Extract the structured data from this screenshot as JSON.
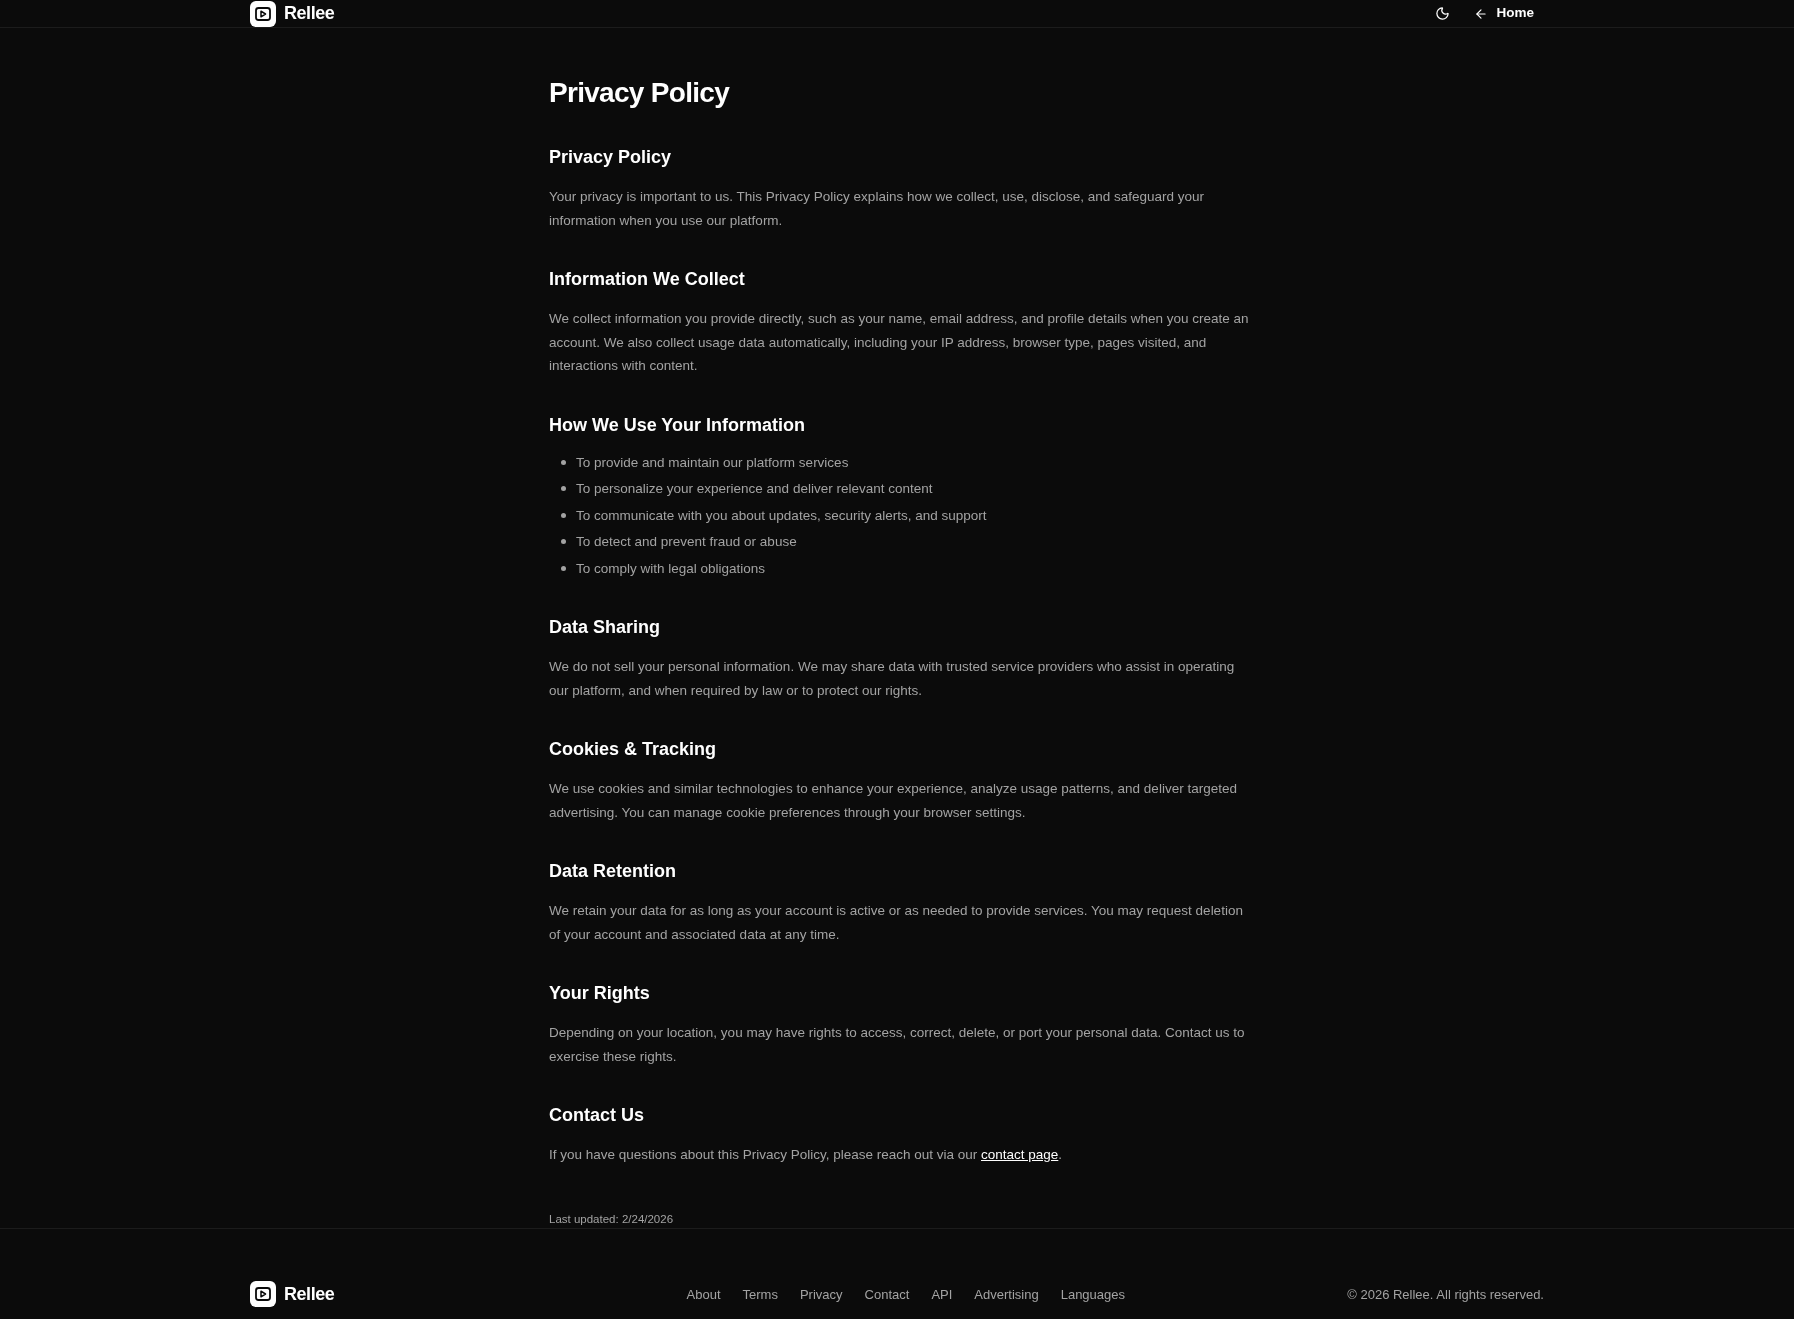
{
  "header": {
    "brand": "Rellee",
    "home_link": "Home"
  },
  "page": {
    "title": "Privacy Policy",
    "sections": [
      {
        "kind": "paragraph",
        "heading": "Privacy Policy",
        "text": "Your privacy is important to us. This Privacy Policy explains how we collect, use, disclose, and safeguard your information when you use our platform."
      },
      {
        "kind": "paragraph",
        "heading": "Information We Collect",
        "text": "We collect information you provide directly, such as your name, email address, and profile details when you create an account. We also collect usage data automatically, including your IP address, browser type, pages visited, and interactions with content."
      },
      {
        "kind": "list",
        "heading": "How We Use Your Information",
        "items": [
          "To provide and maintain our platform services",
          "To personalize your experience and deliver relevant content",
          "To communicate with you about updates, security alerts, and support",
          "To detect and prevent fraud or abuse",
          "To comply with legal obligations"
        ]
      },
      {
        "kind": "paragraph",
        "heading": "Data Sharing",
        "text": "We do not sell your personal information. We may share data with trusted service providers who assist in operating our platform, and when required by law or to protect our rights."
      },
      {
        "kind": "paragraph",
        "heading": "Cookies & Tracking",
        "text": "We use cookies and similar technologies to enhance your experience, analyze usage patterns, and deliver targeted advertising. You can manage cookie preferences through your browser settings."
      },
      {
        "kind": "paragraph",
        "heading": "Data Retention",
        "text": "We retain your data for as long as your account is active or as needed to provide services. You may request deletion of your account and associated data at any time."
      },
      {
        "kind": "paragraph",
        "heading": "Your Rights",
        "text": "Depending on your location, you may have rights to access, correct, delete, or port your personal data. Contact us to exercise these rights."
      },
      {
        "kind": "link",
        "heading": "Contact Us",
        "text": "If you have questions about this Privacy Policy, please reach out via our",
        "link": "contact page",
        "text_after": "."
      }
    ],
    "last_updated": "Last updated: 2/24/2026"
  },
  "footer": {
    "brand": "Rellee",
    "links": [
      "About",
      "Terms",
      "Privacy",
      "Contact",
      "API",
      "Advertising",
      "Languages"
    ],
    "copyright": "© 2026 Rellee. All rights reserved."
  }
}
